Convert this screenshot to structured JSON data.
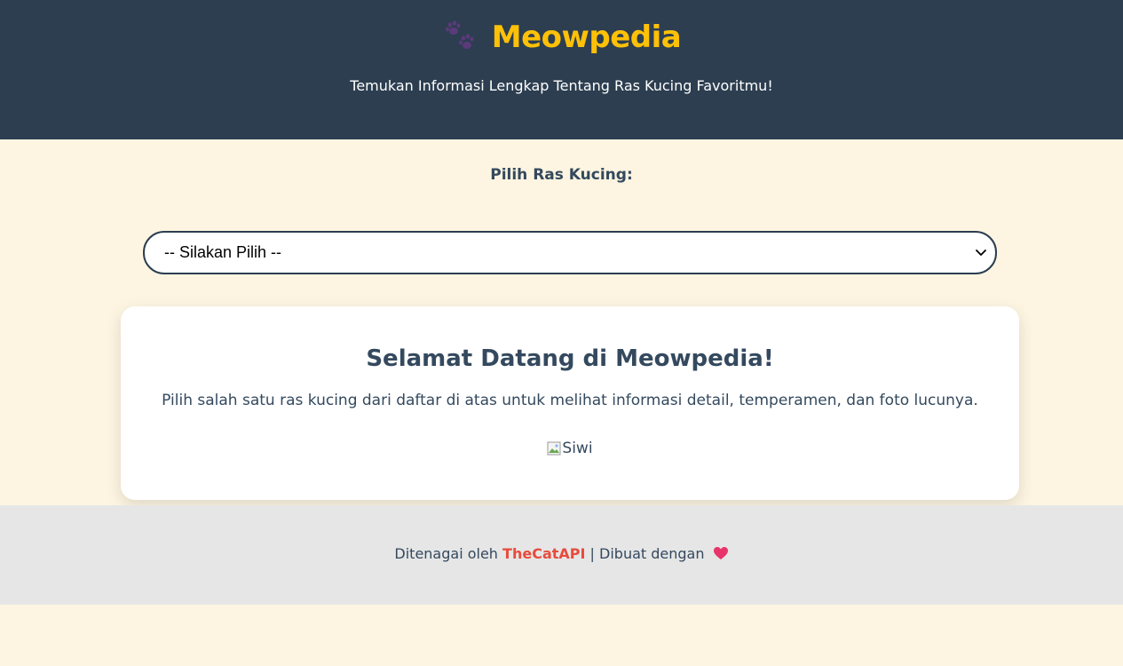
{
  "header": {
    "title": "Meowpedia",
    "tagline": "Temukan Informasi Lengkap Tentang Ras Kucing Favoritmu!",
    "icon": "paw-prints-icon",
    "title_color": "#ffc107",
    "background": "#2c3e50"
  },
  "selector": {
    "label": "Pilih Ras Kucing:",
    "selected": "-- Silakan Pilih --"
  },
  "welcome": {
    "title": "Selamat Datang di Meowpedia!",
    "text": "Pilih salah satu ras kucing dari daftar di atas untuk melihat informasi detail, temperamen, dan foto lucunya.",
    "image_alt": "Siwi"
  },
  "footer": {
    "prefix": "Ditenagai oleh",
    "link_text": "TheCatAPI",
    "suffix": "| Dibuat dengan",
    "heart_icon": "heart-icon",
    "link_color": "#e74c3c"
  },
  "colors": {
    "page_background": "#fdf5e1",
    "footer_background": "#e6e6e6"
  }
}
